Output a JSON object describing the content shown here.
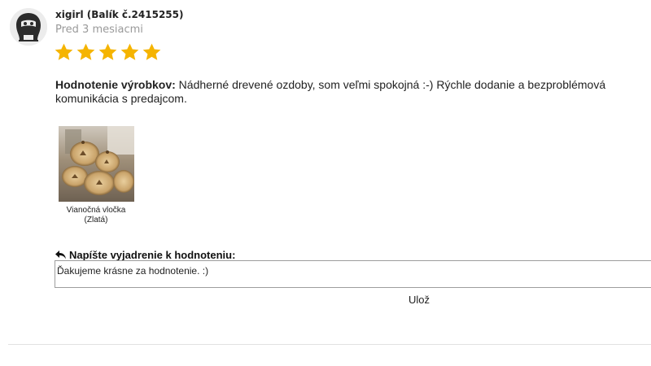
{
  "reviewer": {
    "name": "xigirl (Balík č.2415255)",
    "time_ago": "Pred 3 mesiacmi",
    "avatar_icon": "ninja-face-icon"
  },
  "rating": {
    "stars": 5,
    "max": 5,
    "color": "#f5b400"
  },
  "review": {
    "label": "Hodnotenie výrobkov:",
    "text": " Nádherné drevené ozdoby, som veľmi spokojná :-) Rýchle dodanie a bezproblémová komunikácia s predajcom."
  },
  "product": {
    "name": "Vianočná vločka",
    "variant": "(Zlatá)"
  },
  "reply": {
    "label": "Napíšte vyjadrenie k hodnoteniu:",
    "icon": "reply-arrow-icon",
    "value": "Ďakujeme krásne za hodnotenie. :)"
  },
  "save_button": {
    "label": "Ulož"
  }
}
